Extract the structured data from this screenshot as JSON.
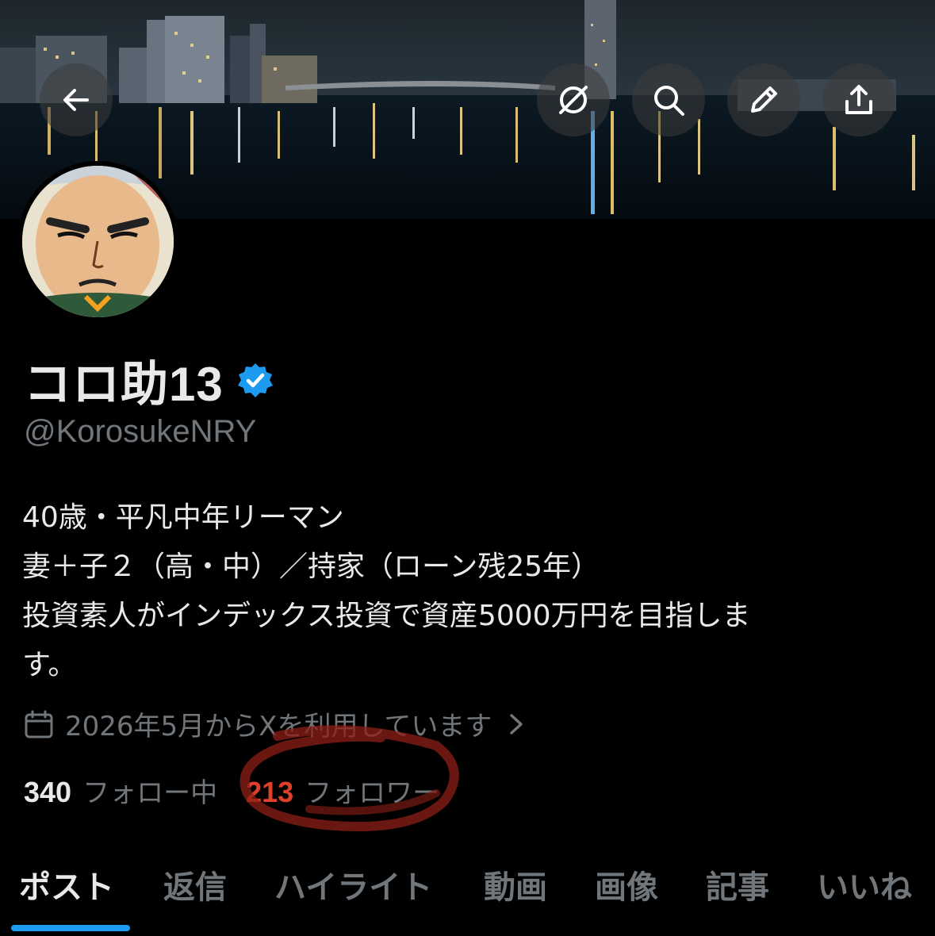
{
  "header": {
    "back_icon": "arrow-left-icon",
    "actions": [
      {
        "name": "grok-icon"
      },
      {
        "name": "search-icon"
      },
      {
        "name": "edit-icon"
      },
      {
        "name": "share-icon"
      }
    ]
  },
  "profile": {
    "name": "コロ助13",
    "verified": true,
    "handle": "@KorosukeNRY",
    "bio_lines": [
      "40歳・平凡中年リーマン",
      "妻＋子２（高・中）／持家（ローン残25年）",
      "投資素人がインデックス投資で資産5000万円を目指しま",
      "す。"
    ],
    "joined": "2026年5月からXを利用しています",
    "following_count": "340",
    "following_label": "フォロー中",
    "followers_count": "213",
    "followers_label": "フォロワー"
  },
  "tabs": [
    {
      "label": "ポスト",
      "active": true
    },
    {
      "label": "返信",
      "active": false
    },
    {
      "label": "ハイライト",
      "active": false
    },
    {
      "label": "動画",
      "active": false
    },
    {
      "label": "画像",
      "active": false
    },
    {
      "label": "記事",
      "active": false
    },
    {
      "label": "いいね",
      "active": false
    }
  ],
  "colors": {
    "accent": "#1d9bf0",
    "annotation": "#c0392b",
    "muted": "#71767b"
  }
}
